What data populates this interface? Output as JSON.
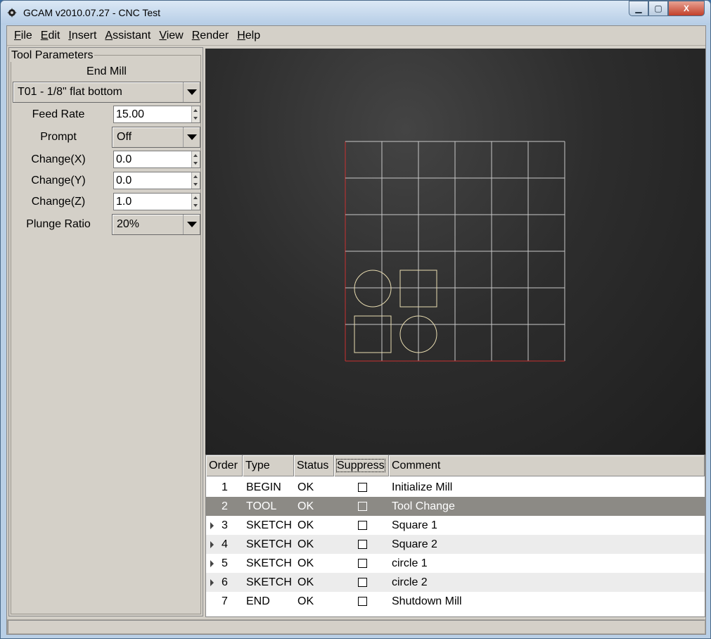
{
  "window": {
    "title": "GCAM v2010.07.27 - CNC Test",
    "minimize_glyph": "▁",
    "maximize_glyph": "▢",
    "close_glyph": "X"
  },
  "menu": [
    {
      "u": "F",
      "rest": "ile"
    },
    {
      "u": "E",
      "rest": "dit"
    },
    {
      "u": "I",
      "rest": "nsert"
    },
    {
      "u": "A",
      "rest": "ssistant"
    },
    {
      "u": "V",
      "rest": "iew"
    },
    {
      "u": "R",
      "rest": "ender"
    },
    {
      "u": "H",
      "rest": "elp"
    }
  ],
  "tool_params": {
    "group_title": "Tool Parameters",
    "tool_type": "End Mill",
    "tool_select": "T01 - 1/8\" flat bottom",
    "feed_rate_label": "Feed Rate",
    "feed_rate_value": "15.00",
    "prompt_label": "Prompt",
    "prompt_value": "Off",
    "change_x_label": "Change(X)",
    "change_x_value": "0.0",
    "change_y_label": "Change(Y)",
    "change_y_value": "0.0",
    "change_z_label": "Change(Z)",
    "change_z_value": "1.0",
    "plunge_label": "Plunge Ratio",
    "plunge_value": "20%"
  },
  "viewport": {
    "grid_color": "#c8c8c8",
    "axis_color": "#c83030",
    "shape_color": "#e8dcb0",
    "grid_cols": 6,
    "grid_rows": 6
  },
  "table": {
    "headers": [
      "Order",
      "Type",
      "Status",
      "Suppress",
      "Comment"
    ],
    "rows": [
      {
        "order": "1",
        "type": "BEGIN",
        "status": "OK",
        "comment": "Initialize Mill",
        "expandable": false,
        "selected": false
      },
      {
        "order": "2",
        "type": "TOOL",
        "status": "OK",
        "comment": "Tool Change",
        "expandable": false,
        "selected": true
      },
      {
        "order": "3",
        "type": "SKETCH",
        "status": "OK",
        "comment": "Square 1",
        "expandable": true,
        "selected": false
      },
      {
        "order": "4",
        "type": "SKETCH",
        "status": "OK",
        "comment": "Square 2",
        "expandable": true,
        "selected": false
      },
      {
        "order": "5",
        "type": "SKETCH",
        "status": "OK",
        "comment": "circle 1",
        "expandable": true,
        "selected": false
      },
      {
        "order": "6",
        "type": "SKETCH",
        "status": "OK",
        "comment": "circle 2",
        "expandable": true,
        "selected": false
      },
      {
        "order": "7",
        "type": "END",
        "status": "OK",
        "comment": "Shutdown Mill",
        "expandable": false,
        "selected": false
      }
    ]
  }
}
